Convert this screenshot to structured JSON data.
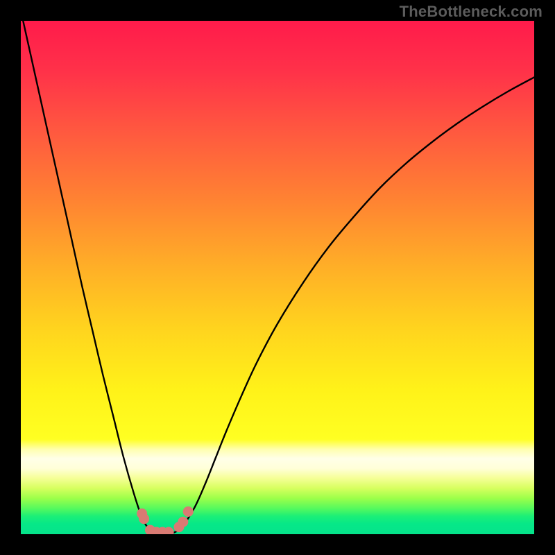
{
  "watermark": "TheBottleneck.com",
  "chart_data": {
    "type": "line",
    "title": "",
    "xlabel": "",
    "ylabel": "",
    "xlim": [
      0,
      100
    ],
    "ylim": [
      0,
      100
    ],
    "series": [
      {
        "name": "bottleneck-left-branch",
        "x": [
          0,
          2,
          4,
          6,
          8,
          10,
          12,
          14,
          16,
          18,
          20,
          22,
          23.5,
          24.5,
          25.5,
          26.5,
          27.5
        ],
        "y": [
          102,
          93,
          84,
          75,
          66,
          57,
          48,
          39.5,
          31,
          23,
          15,
          8,
          3.5,
          1.6,
          0.6,
          0.2,
          0
        ]
      },
      {
        "name": "bottleneck-right-branch",
        "x": [
          28,
          29,
          30,
          31,
          32,
          34,
          36,
          38,
          40,
          43,
          46,
          50,
          55,
          60,
          65,
          70,
          75,
          80,
          85,
          90,
          95,
          100
        ],
        "y": [
          0,
          0.1,
          0.4,
          1,
          2.2,
          5.5,
          10,
          15,
          20,
          27,
          33.5,
          41,
          49,
          56,
          62,
          67.5,
          72.2,
          76.3,
          80,
          83.3,
          86.3,
          89
        ]
      }
    ],
    "markers": [
      {
        "name": "marker",
        "x": 23.6,
        "y": 4.0
      },
      {
        "name": "marker",
        "x": 24.0,
        "y": 3.0
      },
      {
        "name": "marker",
        "x": 25.2,
        "y": 0.8
      },
      {
        "name": "marker",
        "x": 26.4,
        "y": 0.4
      },
      {
        "name": "marker",
        "x": 27.6,
        "y": 0.4
      },
      {
        "name": "marker",
        "x": 28.8,
        "y": 0.4
      },
      {
        "name": "marker",
        "x": 30.8,
        "y": 1.4
      },
      {
        "name": "marker",
        "x": 31.6,
        "y": 2.4
      },
      {
        "name": "marker",
        "x": 32.6,
        "y": 4.4
      }
    ],
    "gradient_stops": [
      {
        "offset": 0.0,
        "color": "#ff1b4b"
      },
      {
        "offset": 0.1,
        "color": "#ff3249"
      },
      {
        "offset": 0.22,
        "color": "#ff5a3f"
      },
      {
        "offset": 0.35,
        "color": "#ff8332"
      },
      {
        "offset": 0.48,
        "color": "#ffaf27"
      },
      {
        "offset": 0.6,
        "color": "#ffd41e"
      },
      {
        "offset": 0.72,
        "color": "#fff219"
      },
      {
        "offset": 0.815,
        "color": "#ffff22"
      },
      {
        "offset": 0.835,
        "color": "#ffffb0"
      },
      {
        "offset": 0.853,
        "color": "#ffffe8"
      },
      {
        "offset": 0.872,
        "color": "#ffffd8"
      },
      {
        "offset": 0.89,
        "color": "#f6ff9a"
      },
      {
        "offset": 0.91,
        "color": "#d8ff60"
      },
      {
        "offset": 0.93,
        "color": "#9cff4a"
      },
      {
        "offset": 0.95,
        "color": "#55f95e"
      },
      {
        "offset": 0.965,
        "color": "#1cef77"
      },
      {
        "offset": 0.98,
        "color": "#06e888"
      },
      {
        "offset": 1.0,
        "color": "#05e38b"
      }
    ],
    "marker_color": "#d97a73",
    "curve_color": "#000000"
  }
}
